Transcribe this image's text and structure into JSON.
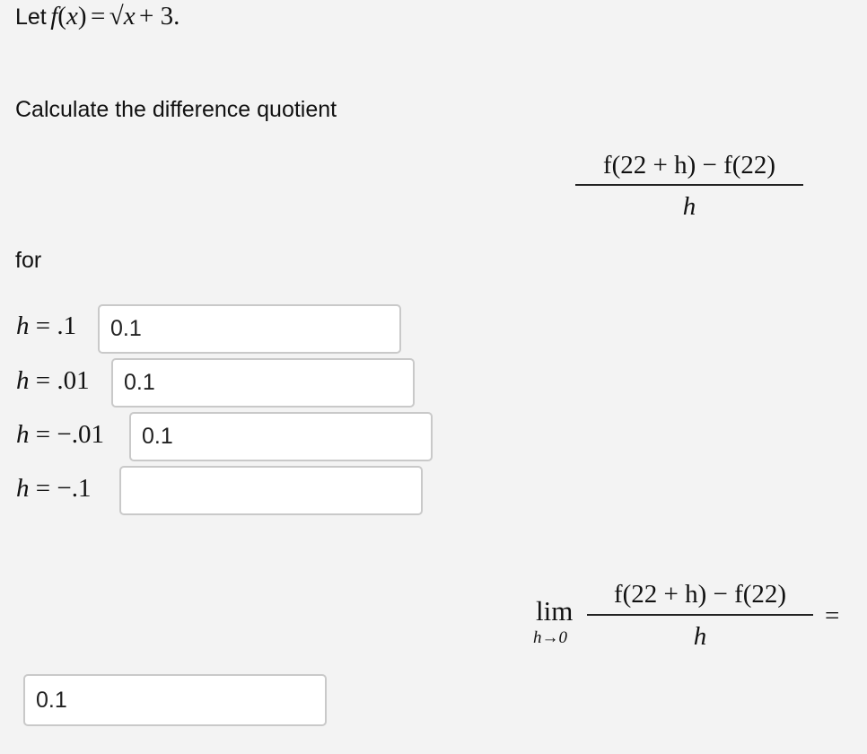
{
  "intro": {
    "let_label": "Let",
    "function": "f",
    "paren_open": "(",
    "var": "x",
    "paren_close": ")",
    "equals": "=",
    "sqrt": "√",
    "plus_three": "+ 3",
    "period": "."
  },
  "instruction": "Calculate the difference quotient",
  "difference_quotient": {
    "numerator": "f(22 + h) − f(22)",
    "denominator": "h"
  },
  "for_label": "for",
  "rows": [
    {
      "var": "h",
      "eq": " = ",
      "value": ".1",
      "input_value": "0.1"
    },
    {
      "var": "h",
      "eq": " = ",
      "value": ".01",
      "input_value": "0.1"
    },
    {
      "var": "h",
      "eq": " = ",
      "value": "−.01",
      "input_value": "0.1"
    },
    {
      "var": "h",
      "eq": " = ",
      "value": "−.1",
      "input_value": ""
    }
  ],
  "limit": {
    "lim_word": "lim",
    "subscript": "h→0",
    "numerator": "f(22 + h) − f(22)",
    "denominator": "h",
    "equals": "="
  },
  "limit_answer": {
    "value": "0.1"
  }
}
